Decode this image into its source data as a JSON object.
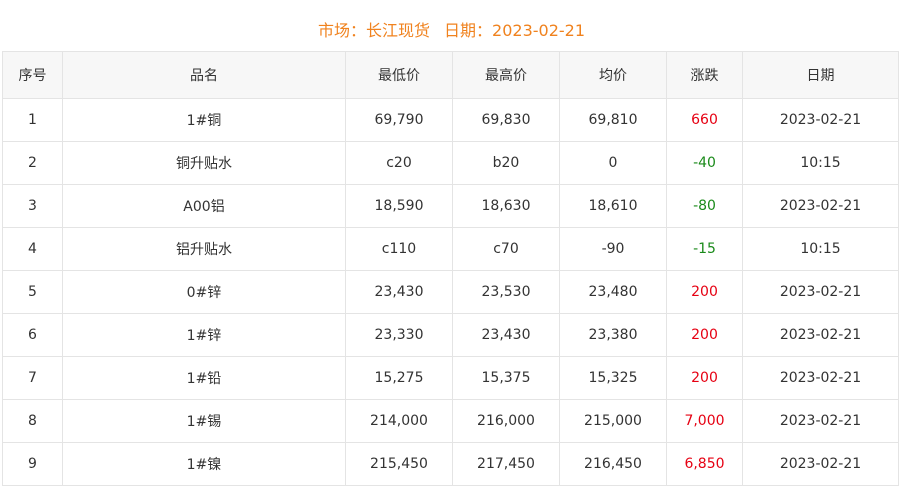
{
  "header": {
    "market_label": "市场：",
    "market_value": "长江现货",
    "date_label": "日期：",
    "date_value": "2023-02-21"
  },
  "table": {
    "columns": [
      "序号",
      "品名",
      "最低价",
      "最高价",
      "均价",
      "涨跌",
      "日期"
    ],
    "rows": [
      {
        "no": "1",
        "name": "1#铜",
        "low": "69,790",
        "high": "69,830",
        "avg": "69,810",
        "change": "660",
        "date": "2023-02-21",
        "trend": "up"
      },
      {
        "no": "2",
        "name": "铜升贴水",
        "low": "c20",
        "high": "b20",
        "avg": "0",
        "change": "-40",
        "date": "10:15",
        "trend": "down"
      },
      {
        "no": "3",
        "name": "A00铝",
        "low": "18,590",
        "high": "18,630",
        "avg": "18,610",
        "change": "-80",
        "date": "2023-02-21",
        "trend": "down"
      },
      {
        "no": "4",
        "name": "铝升贴水",
        "low": "c110",
        "high": "c70",
        "avg": "-90",
        "change": "-15",
        "date": "10:15",
        "trend": "down"
      },
      {
        "no": "5",
        "name": "0#锌",
        "low": "23,430",
        "high": "23,530",
        "avg": "23,480",
        "change": "200",
        "date": "2023-02-21",
        "trend": "up"
      },
      {
        "no": "6",
        "name": "1#锌",
        "low": "23,330",
        "high": "23,430",
        "avg": "23,380",
        "change": "200",
        "date": "2023-02-21",
        "trend": "up"
      },
      {
        "no": "7",
        "name": "1#铅",
        "low": "15,275",
        "high": "15,375",
        "avg": "15,325",
        "change": "200",
        "date": "2023-02-21",
        "trend": "up"
      },
      {
        "no": "8",
        "name": "1#锡",
        "low": "214,000",
        "high": "216,000",
        "avg": "215,000",
        "change": "7,000",
        "date": "2023-02-21",
        "trend": "up"
      },
      {
        "no": "9",
        "name": "1#镍",
        "low": "215,450",
        "high": "217,450",
        "avg": "216,450",
        "change": "6,850",
        "date": "2023-02-21",
        "trend": "up"
      }
    ]
  },
  "colors": {
    "title": "#f0821e",
    "up": "#e60012",
    "down": "#1a8a1a",
    "header_bg": "#f7f7f7",
    "border": "#e4e4e4"
  }
}
